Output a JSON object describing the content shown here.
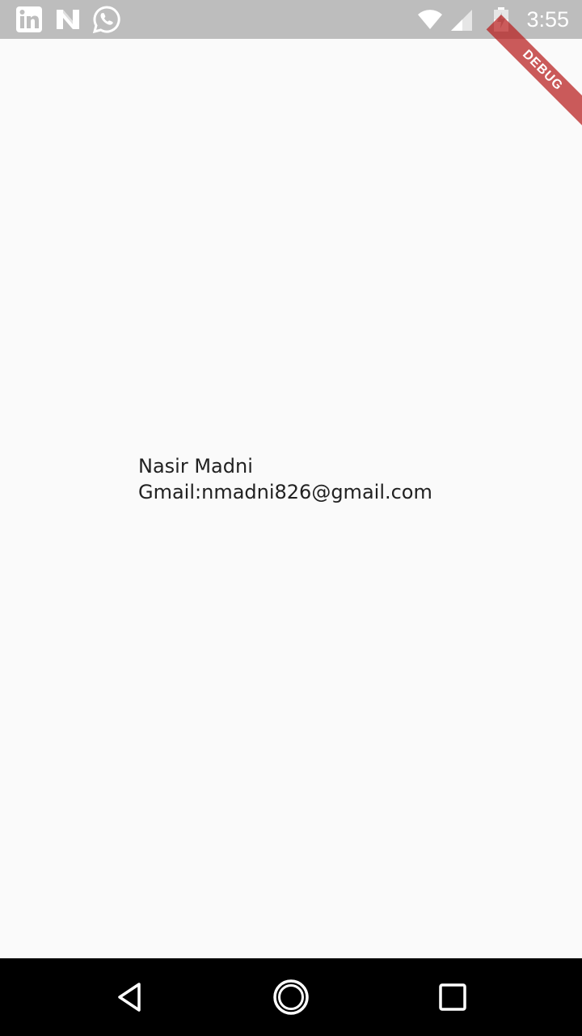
{
  "status_bar": {
    "time": "3:55",
    "background_color": "#bdbdbd",
    "left_icons": [
      "linkedin-icon",
      "n-app-icon",
      "whatsapp-icon"
    ],
    "right_icons": [
      "wifi-icon",
      "signal-icon",
      "battery-icon"
    ]
  },
  "debug_banner": {
    "label": "DEBUG",
    "color": "#b71c1c"
  },
  "profile": {
    "name": "Nasir Madni",
    "email_line": "Gmail:nmadni826@gmail.com"
  },
  "navigation_bar": {
    "buttons": [
      "back-icon",
      "home-icon",
      "recents-icon"
    ],
    "background_color": "#000000"
  }
}
